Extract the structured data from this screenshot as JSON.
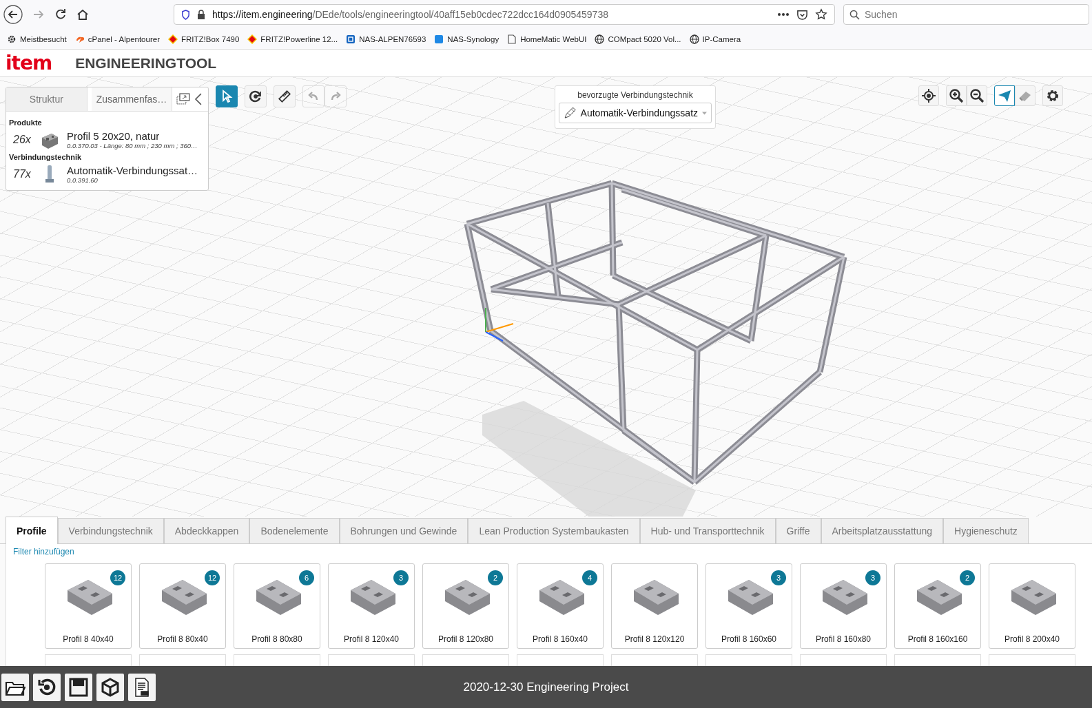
{
  "browser": {
    "url_host": "https://item.engineering",
    "url_path": "/DEde/tools/engineeringtool/40aff15eb0cdec722dcc164d0905459738",
    "search_placeholder": "Suchen"
  },
  "bookmarks": [
    {
      "kind": "gear",
      "label": "Meistbesucht"
    },
    {
      "kind": "cpanel",
      "label": "cPanel - Alpentourer"
    },
    {
      "kind": "fritz",
      "label": "FRITZ!Box 7490"
    },
    {
      "kind": "fritz",
      "label": "FRITZ!Powerline 12..."
    },
    {
      "kind": "nas",
      "label": "NAS-ALPEN76593"
    },
    {
      "kind": "dsm",
      "label": "NAS-Synology"
    },
    {
      "kind": "page",
      "label": "HomeMatic WebUI"
    },
    {
      "kind": "globe",
      "label": "COMpact 5020 Vol..."
    },
    {
      "kind": "globe",
      "label": "IP-Camera"
    }
  ],
  "app": {
    "logo": "item",
    "title": "ENGINEERINGTOOL"
  },
  "left_panel": {
    "tabs": [
      {
        "label": "Struktur",
        "selected": false
      },
      {
        "label": "Zusammenfas…",
        "selected": true
      }
    ],
    "sections": [
      {
        "heading": "Produkte",
        "items": [
          {
            "kind": "profile",
            "count": "26x",
            "name": "Profil 5 20x20, natur",
            "detail": "0.0.370.03 - Länge: 80 mm ; 230 mm ; 360…"
          }
        ]
      },
      {
        "heading": "Verbindungstechnik",
        "items": [
          {
            "kind": "connector",
            "count": "77x",
            "name": "Automatik-Verbindungssat…",
            "detail": "0.0.391.60"
          }
        ]
      }
    ]
  },
  "tools": [
    {
      "kind": "select",
      "selected": true
    },
    {
      "kind": "rotate",
      "selected": false
    },
    {
      "kind": "measure",
      "selected": false
    },
    {
      "kind": "undo",
      "selected": false
    },
    {
      "kind": "redo",
      "selected": false
    }
  ],
  "connection": {
    "label": "bevorzugte Verbindungstechnik",
    "value": "Automatik-Verbindungssatz"
  },
  "view_tools": [
    {
      "kind": "target",
      "selected": false
    },
    {
      "kind": "zoom-in",
      "selected": false
    },
    {
      "kind": "zoom-out",
      "selected": false
    },
    {
      "kind": "plane",
      "selected": true
    },
    {
      "kind": "eraser",
      "selected": false
    },
    {
      "kind": "gear",
      "selected": false
    }
  ],
  "catalog_tabs": [
    {
      "label": "Profile",
      "selected": true
    },
    {
      "label": "Verbindungstechnik",
      "selected": false
    },
    {
      "label": "Abdeckkappen",
      "selected": false
    },
    {
      "label": "Bodenelemente",
      "selected": false
    },
    {
      "label": "Bohrungen und Gewinde",
      "selected": false
    },
    {
      "label": "Lean Production Systembaukasten",
      "selected": false
    },
    {
      "label": "Hub- und Transporttechnik",
      "selected": false
    },
    {
      "label": "Griffe",
      "selected": false
    },
    {
      "label": "Arbeitsplatzausstattung",
      "selected": false
    },
    {
      "label": "Hygieneschutz",
      "selected": false
    }
  ],
  "filter_link": "Filter hinzufügen",
  "products": [
    {
      "name": "Profil 8 40x40",
      "count": "12"
    },
    {
      "name": "Profil 8 80x40",
      "count": "12"
    },
    {
      "name": "Profil 8 80x80",
      "count": "6"
    },
    {
      "name": "Profil 8 120x40",
      "count": "3"
    },
    {
      "name": "Profil 8 120x80",
      "count": "2"
    },
    {
      "name": "Profil 8 160x40",
      "count": "4"
    },
    {
      "name": "Profil 8 120x120"
    },
    {
      "name": "Profil 8 160x60",
      "count": "3"
    },
    {
      "name": "Profil 8 160x80",
      "count": "3"
    },
    {
      "name": "Profil 8 160x160",
      "count": "2"
    },
    {
      "name": "Profil 8 200x40"
    }
  ],
  "footer": {
    "project_title": "2020-12-30 Engineering Project",
    "actions": [
      {
        "kind": "open"
      },
      {
        "kind": "reset"
      },
      {
        "kind": "save"
      },
      {
        "kind": "cube"
      },
      {
        "kind": "pdf"
      }
    ]
  }
}
